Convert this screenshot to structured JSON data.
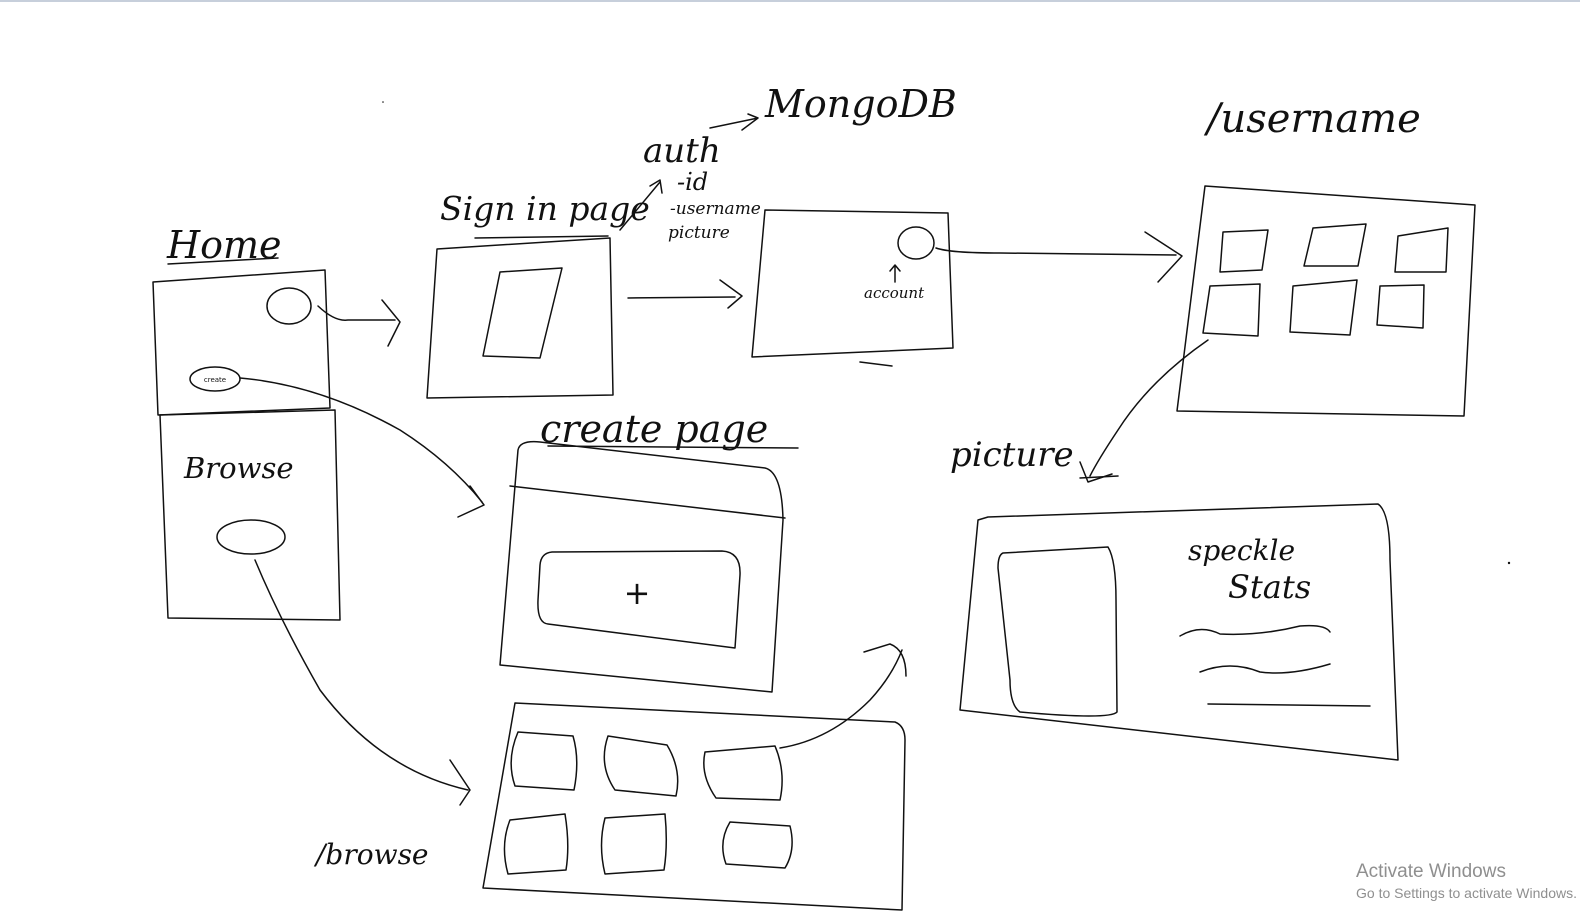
{
  "sketch": {
    "home": {
      "title": "Home",
      "create_button": "create"
    },
    "browse": {
      "title": "Browse",
      "route": "/browse"
    },
    "sign_in": {
      "title": "Sign in page"
    },
    "auth": {
      "title": "auth",
      "target": "MongoDB",
      "fields": [
        "-id",
        "-username",
        "picture"
      ]
    },
    "account": {
      "label": "account"
    },
    "username": {
      "route": "/username"
    },
    "create_page": {
      "title": "create page",
      "add_symbol": "+"
    },
    "picture": {
      "title": "picture",
      "heading_line1": "speckle",
      "heading_line2": "Stats"
    }
  },
  "watermark": {
    "title": "Activate Windows",
    "subtitle": "Go to Settings to activate Windows."
  }
}
